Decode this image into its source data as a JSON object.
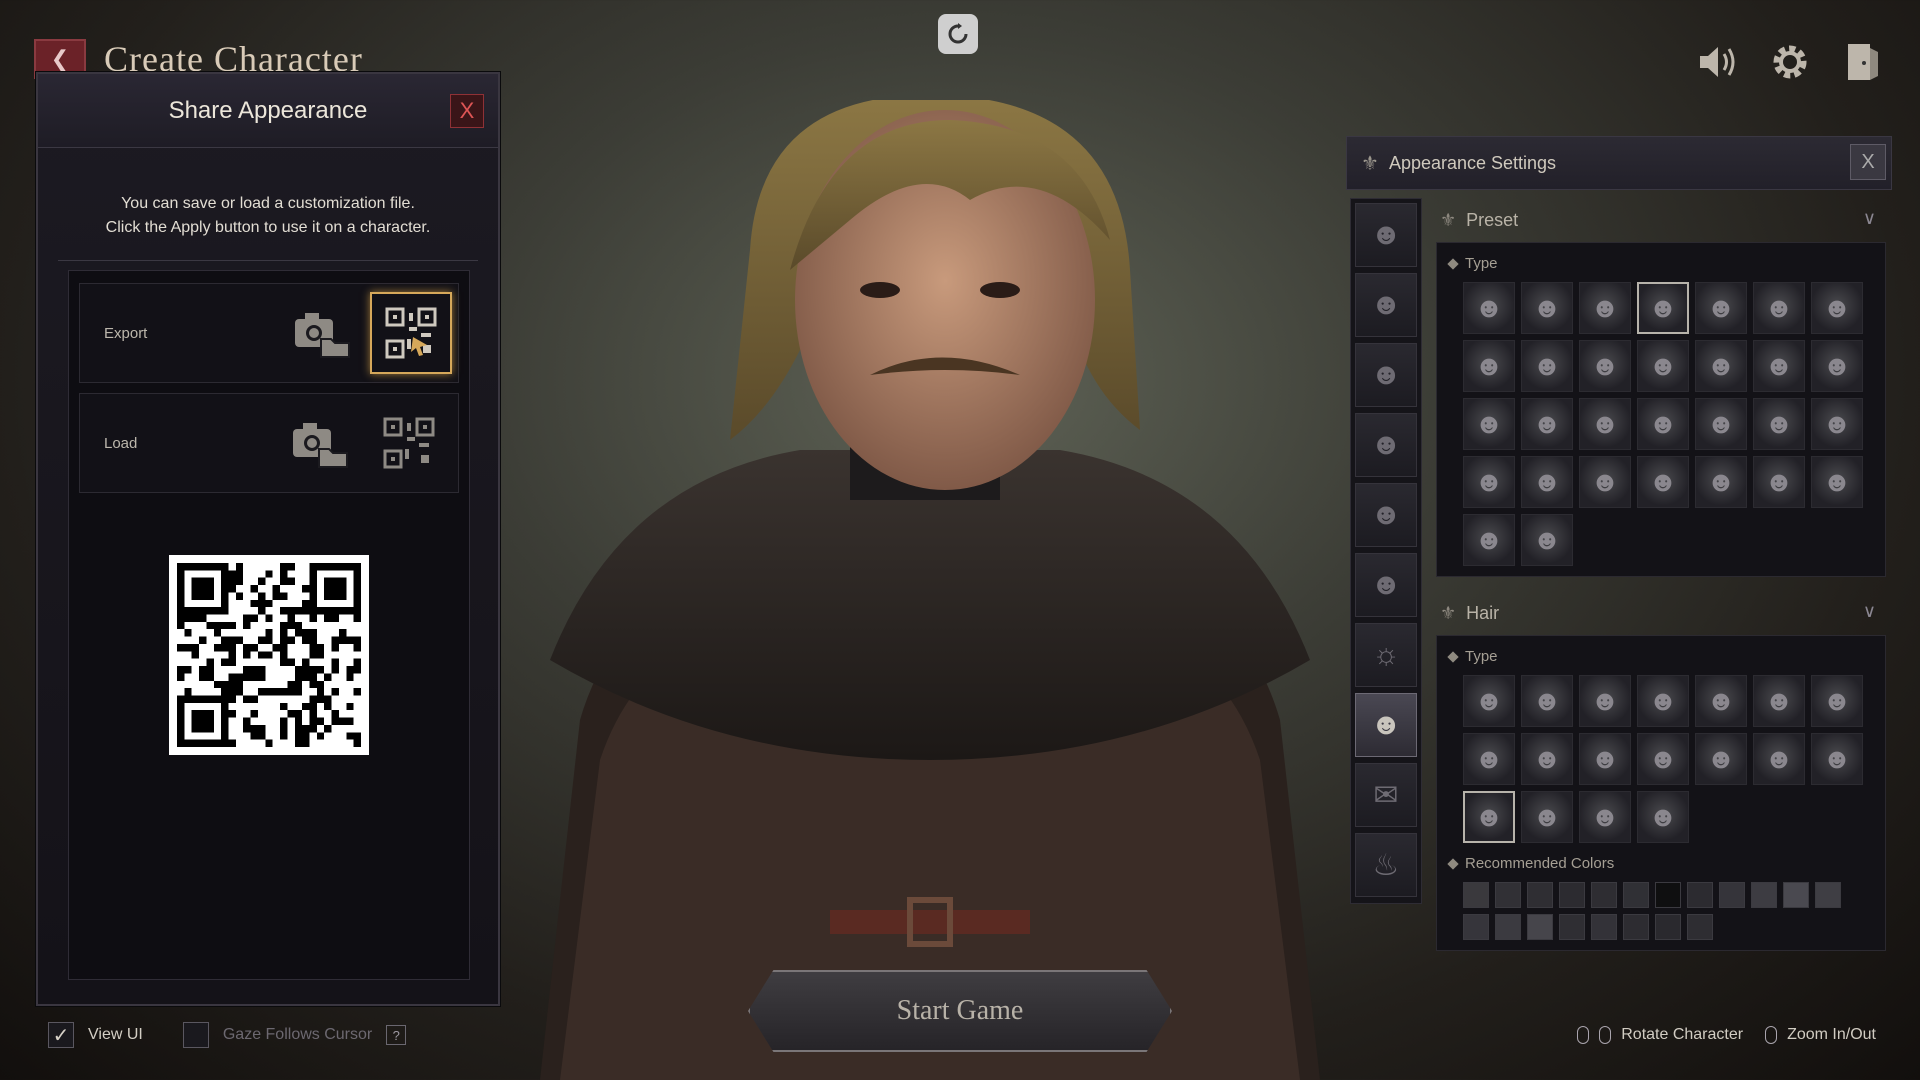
{
  "top": {
    "title": "Create Character",
    "reset_icon": "refresh-icon",
    "sound_icon": "speaker-icon",
    "settings_icon": "gear-icon",
    "exit_icon": "exit-door-icon"
  },
  "share_panel": {
    "title": "Share Appearance",
    "close_label": "X",
    "description_line1": "You can save or load a customization file.",
    "description_line2": "Click the Apply button to use it on a character.",
    "export_label": "Export",
    "load_label": "Load"
  },
  "appearance": {
    "title": "Appearance Settings",
    "close_label": "X",
    "preset": {
      "title": "Preset",
      "type_label": "Type",
      "count": 30,
      "selected_index": 3
    },
    "hair": {
      "title": "Hair",
      "type_label": "Type",
      "count": 18,
      "selected_index": 14,
      "colors_label": "Recommended Colors",
      "colors": [
        "#3a393d",
        "#313035",
        "#2f2e33",
        "#2c2b30",
        "#2e2d32",
        "#303035",
        "#0f0f10",
        "#2c2b30",
        "#35343a",
        "#3d3c42",
        "#4a4950",
        "#3f3e44",
        "#36353b",
        "#3b3a40",
        "#46454b",
        "#2f2e33",
        "#333238",
        "#2d2c31",
        "#2a292e",
        "#2e2d32"
      ]
    }
  },
  "bottom": {
    "start_label": "Start Game",
    "view_ui_label": "View UI",
    "view_ui_checked": true,
    "gaze_label": "Gaze Follows Cursor",
    "help_label": "?",
    "rotate_label": "Rotate Character",
    "zoom_label": "Zoom In/Out"
  }
}
